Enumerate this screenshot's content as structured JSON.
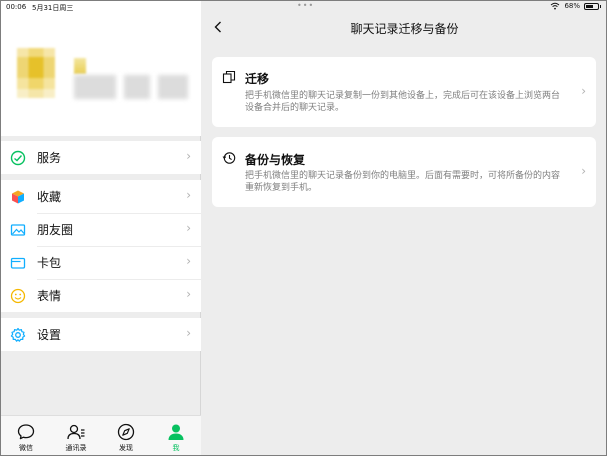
{
  "status_bar": {
    "time": "00:06",
    "date": "5月31日周三",
    "dots": "•••",
    "battery": "68%",
    "battery_level": 0.68,
    "wifi_icon": "wifi-icon",
    "battery_icon": "battery-icon"
  },
  "sidebar": {
    "menu_groups": [
      [
        {
          "label": "服务",
          "icon": "services-icon",
          "chevron": "›"
        }
      ],
      [
        {
          "label": "收藏",
          "icon": "favorites-cube-icon",
          "chevron": "›"
        },
        {
          "label": "朋友圈",
          "icon": "moments-photo-icon",
          "chevron": "›"
        },
        {
          "label": "卡包",
          "icon": "card-wallet-icon",
          "chevron": "›"
        },
        {
          "label": "表情",
          "icon": "sticker-smiley-icon",
          "chevron": "›"
        }
      ],
      [
        {
          "label": "设置",
          "icon": "settings-gear-icon",
          "chevron": "›"
        }
      ]
    ]
  },
  "tabbar": {
    "tabs": [
      {
        "label": "微信",
        "icon": "chat-bubble-icon",
        "active": false
      },
      {
        "label": "通讯录",
        "icon": "contacts-icon",
        "active": false
      },
      {
        "label": "发现",
        "icon": "compass-icon",
        "active": false
      },
      {
        "label": "我",
        "icon": "person-icon",
        "active": true
      }
    ]
  },
  "panel": {
    "back_icon": "back-arrow-icon",
    "title": "聊天记录迁移与备份",
    "cards": [
      {
        "title": "迁移",
        "icon": "migrate-icon",
        "description": "把手机微信里的聊天记录复制一份到其他设备上，完成后可在该设备上浏览两台设备合并后的聊天记录。",
        "chevron": "›"
      },
      {
        "title": "备份与恢复",
        "icon": "backup-clock-icon",
        "description": "把手机微信里的聊天记录备份到你的电脑里。后面有需要时，可将所备份的内容重新恢复到手机。",
        "chevron": "›"
      }
    ]
  },
  "colors": {
    "accent": "#07c160",
    "background": "#ededed",
    "card": "#ffffff",
    "secondary_text": "#7f7f7f",
    "chevron": "#b2b2b2"
  }
}
